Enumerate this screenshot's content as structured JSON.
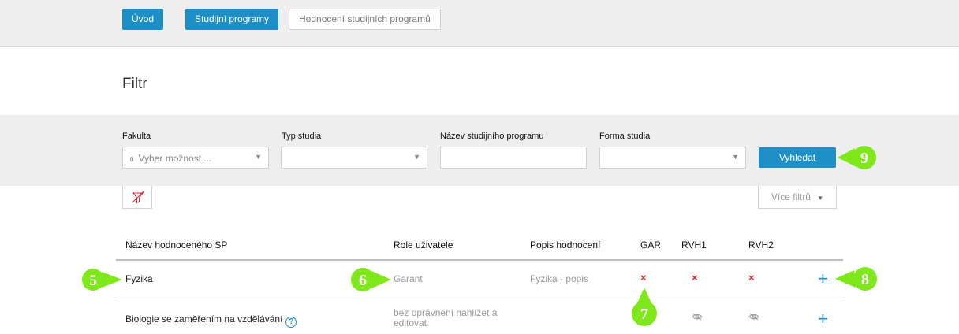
{
  "nav": {
    "tabs": [
      {
        "label": "Úvod"
      },
      {
        "label": "Studijní programy"
      },
      {
        "label": "Hodnocení studijních programů"
      }
    ]
  },
  "filter": {
    "title": "Filtr",
    "fields": {
      "faculty": {
        "label": "Fakulta",
        "count": "0",
        "value": "Vyber možnost ..."
      },
      "study_type": {
        "label": "Typ studia",
        "value": ""
      },
      "program_name": {
        "label": "Název studijního programu",
        "value": ""
      },
      "study_form": {
        "label": "Forma studia",
        "value": ""
      }
    },
    "search_label": "Vyhledat",
    "more_filters_label": "Více filtrů"
  },
  "table": {
    "columns": [
      "Název hodnoceného SP",
      "Role uživatele",
      "Popis hodnocení",
      "GAR",
      "RVH1",
      "RVH2"
    ],
    "rows": [
      {
        "name": "Fyzika",
        "role": "Garant",
        "description": "Fyzika - popis",
        "gar": "×",
        "rvh1": "×",
        "rvh2": "×",
        "action": "+"
      },
      {
        "name": "Biologie se zaměřením na vzdělávání",
        "help": "?",
        "role_line1": "bez oprávnění nahlížet a",
        "role_line2": "editovat",
        "action": "+"
      }
    ]
  },
  "callouts": {
    "c5": "5",
    "c6": "6",
    "c7": "7",
    "c8": "8",
    "c9": "9"
  },
  "colors": {
    "accent": "#1e8fc6",
    "cross": "#e0222e",
    "callout": "#7ee81a"
  }
}
